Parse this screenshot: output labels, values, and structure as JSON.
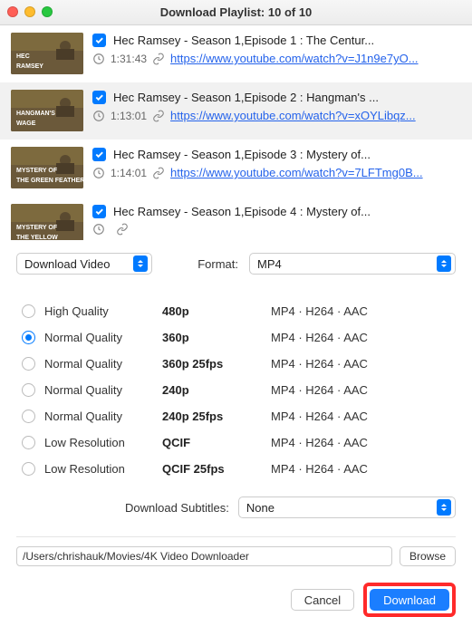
{
  "window": {
    "title": "Download Playlist: 10 of 10"
  },
  "playlist": [
    {
      "title": "Hec Ramsey - Season 1,Episode 1 : The Centur...",
      "duration": "1:31:43",
      "url": "https://www.youtube.com/watch?v=J1n9e7yO...",
      "thumb_label": "HEC\nRAMSEY",
      "selected": false
    },
    {
      "title": "Hec Ramsey - Season 1,Episode 2 : Hangman's ...",
      "duration": "1:13:01",
      "url": "https://www.youtube.com/watch?v=xOYLibqz...",
      "thumb_label": "HANGMAN'S\nWAGE",
      "selected": true
    },
    {
      "title": "Hec Ramsey - Season 1,Episode 3 : Mystery of...",
      "duration": "1:14:01",
      "url": "https://www.youtube.com/watch?v=7LFTmg0B...",
      "thumb_label": "MYSTERY OF\nTHE GREEN FEATHER",
      "selected": false
    },
    {
      "title": "Hec Ramsey - Season 1,Episode 4 : Mystery of...",
      "duration": "",
      "url": "",
      "thumb_label": "MYSTERY OF\nTHE YELLOW",
      "selected": false
    }
  ],
  "download_mode": "Download Video",
  "format_label": "Format:",
  "format_value": "MP4",
  "qualities": [
    {
      "name": "High Quality",
      "res": "480p",
      "codec": "MP4 · H264 · AAC",
      "checked": false
    },
    {
      "name": "Normal Quality",
      "res": "360p",
      "codec": "MP4 · H264 · AAC",
      "checked": true
    },
    {
      "name": "Normal Quality",
      "res": "360p 25fps",
      "codec": "MP4 · H264 · AAC",
      "checked": false
    },
    {
      "name": "Normal Quality",
      "res": "240p",
      "codec": "MP4 · H264 · AAC",
      "checked": false
    },
    {
      "name": "Normal Quality",
      "res": "240p 25fps",
      "codec": "MP4 · H264 · AAC",
      "checked": false
    },
    {
      "name": "Low Resolution",
      "res": "QCIF",
      "codec": "MP4 · H264 · AAC",
      "checked": false
    },
    {
      "name": "Low Resolution",
      "res": "QCIF 25fps",
      "codec": "MP4 · H264 · AAC",
      "checked": false
    }
  ],
  "subtitles": {
    "label": "Download Subtitles:",
    "value": "None"
  },
  "path": "/Users/chrishauk/Movies/4K Video Downloader",
  "buttons": {
    "browse": "Browse",
    "cancel": "Cancel",
    "download": "Download"
  }
}
